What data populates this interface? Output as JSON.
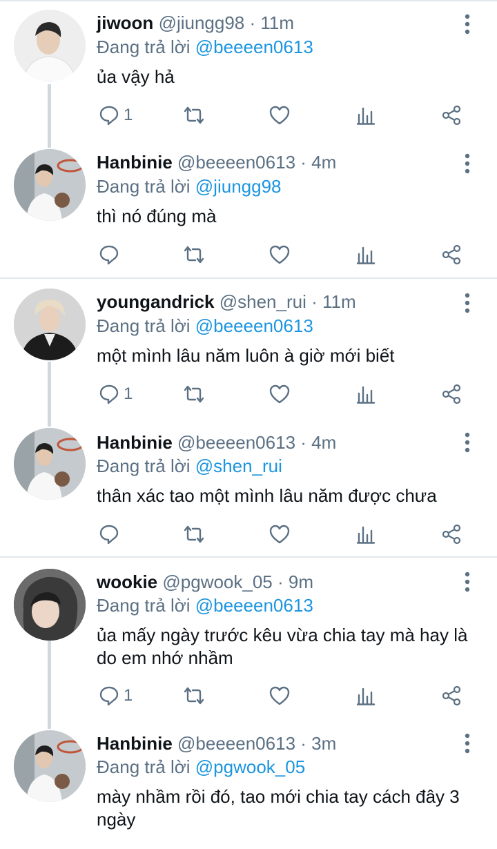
{
  "tweets": [
    {
      "name": "jiwoon",
      "meta": "@jiungg98 · 11m",
      "reply_prefix": "Đang trả lời ",
      "reply_to": "@beeeen0613",
      "text": "ủa vậy hả",
      "reply_count": "1",
      "avatar_bg": "#f2f2f2"
    },
    {
      "name": "Hanbinie",
      "meta": "@beeeen0613 · 4m",
      "reply_prefix": "Đang trả lời ",
      "reply_to": "@jiungg98",
      "text": "thì nó đúng mà",
      "reply_count": "",
      "avatar_bg": "#b9c0c4"
    },
    {
      "name": "youngandrick",
      "meta": "@shen_rui · 11m",
      "reply_prefix": "Đang trả lời ",
      "reply_to": "@beeeen0613",
      "text": "một mình lâu năm luôn à giờ mới biết",
      "reply_count": "1",
      "avatar_bg": "#d8d8d8"
    },
    {
      "name": "Hanbinie",
      "meta": "@beeeen0613 · 4m",
      "reply_prefix": "Đang trả lời ",
      "reply_to": "@shen_rui",
      "text": "thân xác tao một mình lâu năm được chưa",
      "reply_count": "",
      "avatar_bg": "#b9c0c4"
    },
    {
      "name": "wookie",
      "meta": "@pgwook_05 · 9m",
      "reply_prefix": "Đang trả lời ",
      "reply_to": "@beeeen0613",
      "text": "ủa mấy ngày trước kêu vừa chia tay mà hay là do em nhớ nhầm",
      "reply_count": "1",
      "avatar_bg": "#5a5a5a"
    },
    {
      "name": "Hanbinie",
      "meta": "@beeeen0613 · 3m",
      "reply_prefix": "Đang trả lời ",
      "reply_to": "@pgwook_05",
      "text": "mày nhầm rồi đó, tao mới chia tay cách đây 3 ngày",
      "reply_count": "",
      "avatar_bg": "#b9c0c4"
    }
  ],
  "icons": {
    "reply": "reply-icon",
    "retweet": "retweet-icon",
    "like": "heart-icon",
    "analytics": "analytics-icon",
    "share": "share-icon",
    "more": "more-vertical-icon"
  },
  "colors": {
    "mention": "#1b95e0",
    "secondary_text": "#5b7083",
    "separator": "#e1e8ed"
  }
}
